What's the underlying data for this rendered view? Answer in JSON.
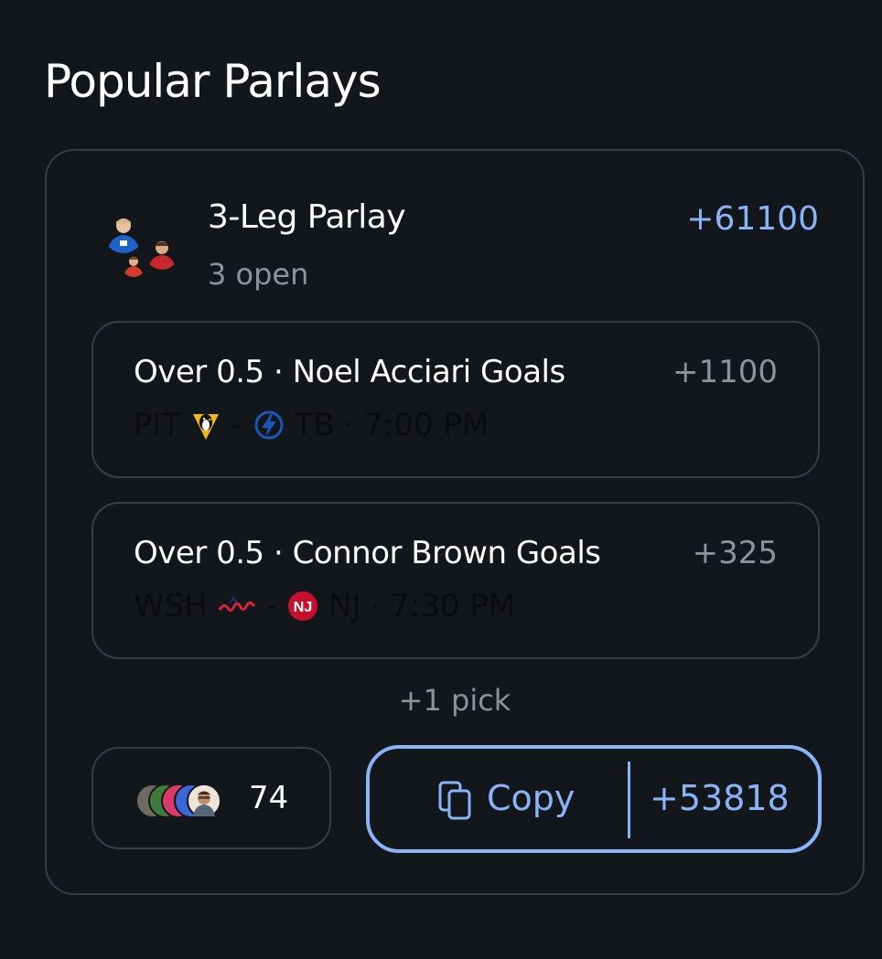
{
  "section_title": "Popular Parlays",
  "parlay": {
    "name": "3-Leg Parlay",
    "status": "3 open",
    "odds": "+61100",
    "legs": [
      {
        "title": "Over 0.5 · Noel Acciari Goals",
        "odds": "+1100",
        "away": "PIT",
        "separator": "-",
        "home": "TB",
        "time": "· 7:00 PM",
        "away_logo": "penguins-logo-icon",
        "home_logo": "lightning-logo-icon"
      },
      {
        "title": "Over 0.5 · Connor Brown Goals",
        "odds": "+325",
        "away": "WSH",
        "separator": "-",
        "home": "NJ",
        "time": "· 7:30 PM",
        "away_logo": "capitals-logo-icon",
        "home_logo": "devils-logo-icon"
      }
    ],
    "more_picks": "+1 pick",
    "followers_count": "74",
    "copy": {
      "label": "Copy",
      "odds": "+53818",
      "icon": "copy-icon"
    }
  },
  "colors": {
    "background": "#13161b",
    "border": "#3a3d44",
    "accent": "#8ab4f8",
    "muted": "#8e9299"
  }
}
